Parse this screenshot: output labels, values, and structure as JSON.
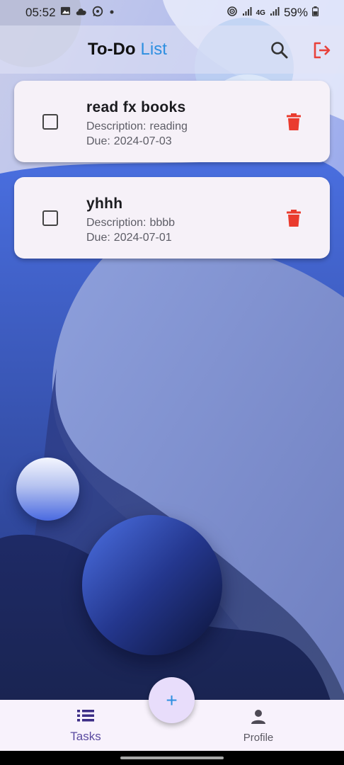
{
  "status_bar": {
    "time": "05:52",
    "battery": "59%",
    "network": "4G",
    "left_icons": [
      "image-icon",
      "cloud-icon",
      "whatsapp-icon",
      "dot-icon"
    ],
    "right_icons": [
      "hotspot-icon",
      "signal-icon",
      "signal-4g-icon",
      "battery-icon"
    ]
  },
  "app_bar": {
    "title_main": "To-Do",
    "title_accent": "List",
    "actions": [
      "search-icon",
      "logout-icon"
    ],
    "accent_color": "#2d8fe0",
    "logout_color": "#e8413b"
  },
  "tasks": [
    {
      "title": "read fx books",
      "description_label": "Description:",
      "description": "reading",
      "due_label": "Due:",
      "due": "2024-07-03",
      "completed": false
    },
    {
      "title": "yhhh",
      "description_label": "Description:",
      "description": "bbbb",
      "due_label": "Due:",
      "due": "2024-07-01",
      "completed": false
    }
  ],
  "fab": {
    "label": "+",
    "icon": "add-icon"
  },
  "bottom_nav": {
    "items": [
      {
        "label": "Tasks",
        "icon": "list-icon",
        "active": true
      },
      {
        "label": "Profile",
        "icon": "person-icon",
        "active": false
      }
    ]
  },
  "colors": {
    "delete": "#ea3b2e",
    "card_bg": "#f6f1f8",
    "nav_active": "#5a4aa0"
  }
}
